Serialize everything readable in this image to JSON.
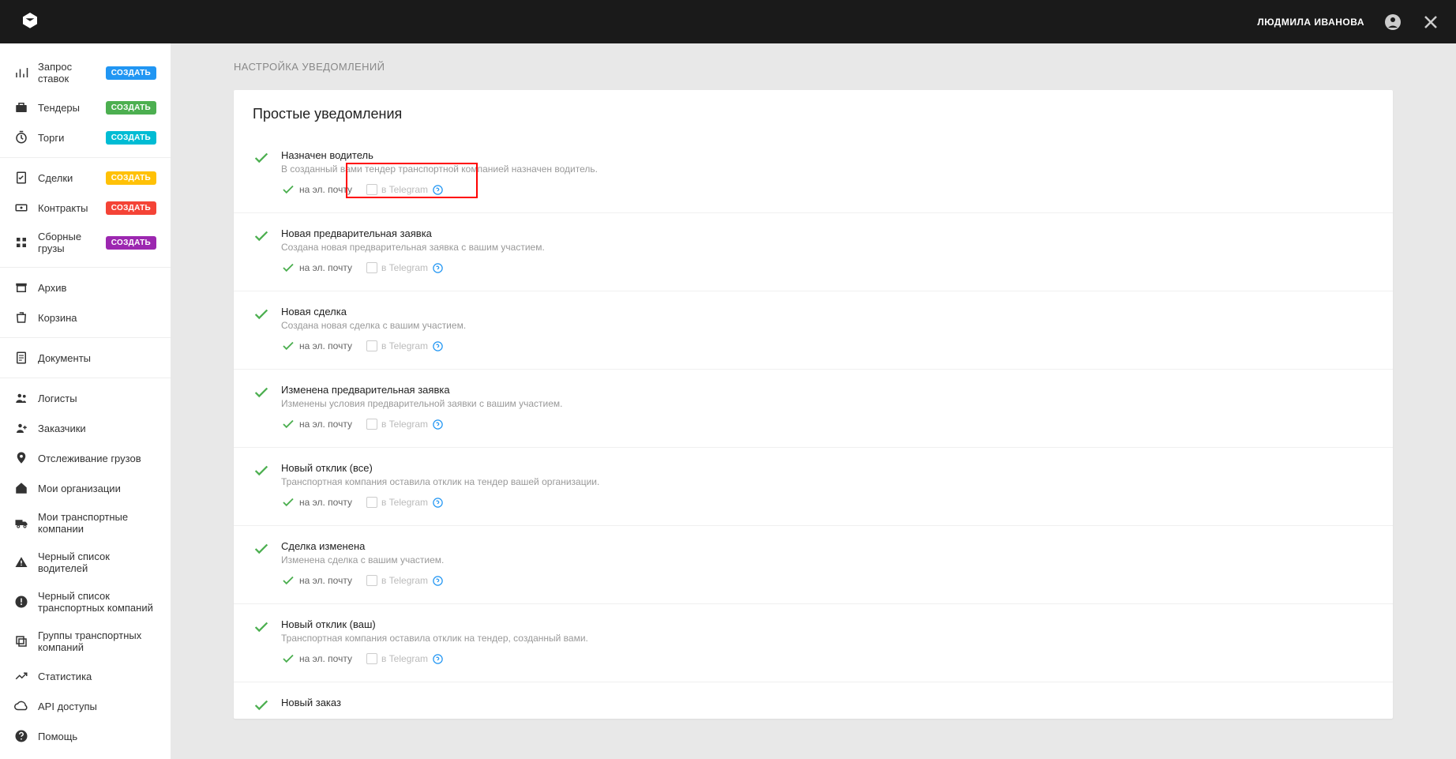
{
  "header": {
    "username": "ЛЮДМИЛА ИВАНОВА"
  },
  "sidebar": {
    "create_label": "СОЗДАТЬ",
    "items": [
      {
        "label": "Запрос ставок"
      },
      {
        "label": "Тендеры"
      },
      {
        "label": "Торги"
      },
      {
        "label": "Сделки"
      },
      {
        "label": "Контракты"
      },
      {
        "label": "Сборные грузы"
      },
      {
        "label": "Архив"
      },
      {
        "label": "Корзина"
      },
      {
        "label": "Документы"
      },
      {
        "label": "Логисты"
      },
      {
        "label": "Заказчики"
      },
      {
        "label": "Отслеживание грузов"
      },
      {
        "label": "Мои организации"
      },
      {
        "label": "Мои транспортные компании"
      },
      {
        "label": "Черный список водителей"
      },
      {
        "label": "Черный список транспортных компаний"
      },
      {
        "label": "Группы транспортных компаний"
      },
      {
        "label": "Статистика"
      },
      {
        "label": "API доступы"
      },
      {
        "label": "Помощь"
      }
    ]
  },
  "page": {
    "title": "НАСТРОЙКА УВЕДОМЛЕНИЙ",
    "section_title": "Простые уведомления"
  },
  "channels": {
    "email": "на эл. почту",
    "telegram": "в Telegram"
  },
  "notifications": [
    {
      "title": "Назначен водитель",
      "desc": "В созданный вами тендер транспортной компанией назначен водитель."
    },
    {
      "title": "Новая предварительная заявка",
      "desc": "Создана новая предварительная заявка с вашим участием."
    },
    {
      "title": "Новая сделка",
      "desc": "Создана новая сделка с вашим участием."
    },
    {
      "title": "Изменена предварительная заявка",
      "desc": "Изменены условия предварительной заявки с вашим участием."
    },
    {
      "title": "Новый отклик (все)",
      "desc": "Транспортная компания оставила отклик на тендер вашей организации."
    },
    {
      "title": "Сделка изменена",
      "desc": "Изменена сделка с вашим участием."
    },
    {
      "title": "Новый отклик (ваш)",
      "desc": "Транспортная компания оставила отклик на тендер, созданный вами."
    },
    {
      "title": "Новый заказ",
      "desc": ""
    }
  ]
}
